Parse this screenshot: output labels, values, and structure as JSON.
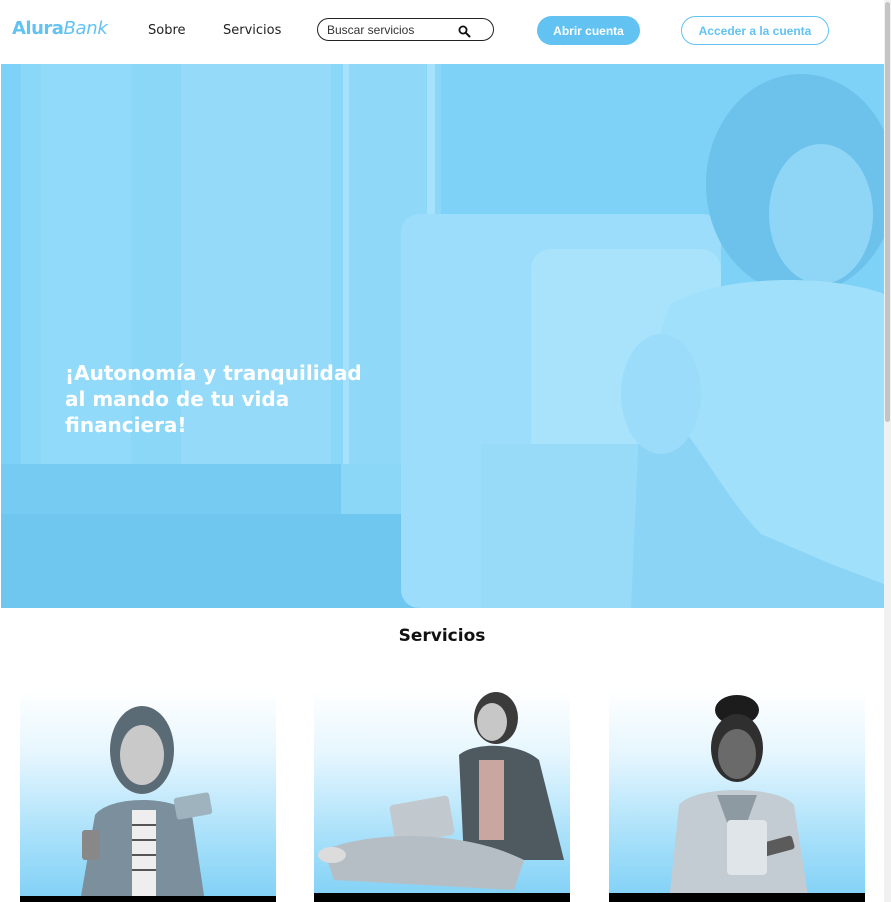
{
  "header": {
    "logo_primary": "Alura",
    "logo_secondary": "Bank",
    "nav": {
      "about": "Sobre",
      "services": "Servicios"
    },
    "search": {
      "placeholder": "Buscar servicios",
      "value": "",
      "icon": "search-icon"
    },
    "open_account_label": "Abrir cuenta",
    "access_account_label": "Acceder a la cuenta"
  },
  "hero": {
    "title": "¡Autonomía y tranquilidad al mando de tu vida financiera!"
  },
  "services": {
    "heading": "Servicios"
  },
  "colors": {
    "accent": "#62c3f2",
    "hero_overlay": "#7fd2f7",
    "text": "#1f1f1f"
  }
}
